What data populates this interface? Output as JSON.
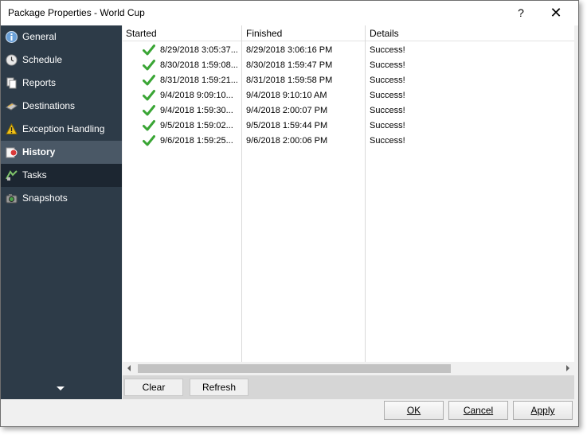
{
  "window": {
    "title": "Package Properties - World Cup",
    "help": "?",
    "close": "✕"
  },
  "sidebar": {
    "items": [
      {
        "label": "General",
        "icon": "info-icon"
      },
      {
        "label": "Schedule",
        "icon": "clock-icon"
      },
      {
        "label": "Reports",
        "icon": "reports-icon"
      },
      {
        "label": "Destinations",
        "icon": "destinations-icon"
      },
      {
        "label": "Exception Handling",
        "icon": "warning-icon"
      },
      {
        "label": "History",
        "icon": "history-icon",
        "active": true
      },
      {
        "label": "Tasks",
        "icon": "tasks-icon"
      },
      {
        "label": "Snapshots",
        "icon": "snapshots-icon"
      }
    ]
  },
  "grid": {
    "columns": [
      "Started",
      "Finished",
      "Details"
    ],
    "rows": [
      {
        "started": "8/29/2018 3:05:37...",
        "finished": "8/29/2018 3:06:16 PM",
        "details": "Success!"
      },
      {
        "started": "8/30/2018 1:59:08...",
        "finished": "8/30/2018 1:59:47 PM",
        "details": "Success!"
      },
      {
        "started": "8/31/2018 1:59:21...",
        "finished": "8/31/2018 1:59:58 PM",
        "details": "Success!"
      },
      {
        "started": "9/4/2018 9:09:10...",
        "finished": "9/4/2018 9:10:10 AM",
        "details": "Success!"
      },
      {
        "started": "9/4/2018 1:59:30...",
        "finished": "9/4/2018 2:00:07 PM",
        "details": "Success!"
      },
      {
        "started": "9/5/2018 1:59:02...",
        "finished": "9/5/2018 1:59:44 PM",
        "details": "Success!"
      },
      {
        "started": "9/6/2018 1:59:25...",
        "finished": "9/6/2018 2:00:06 PM",
        "details": "Success!"
      }
    ]
  },
  "actions": {
    "clear": "Clear",
    "refresh": "Refresh"
  },
  "footer": {
    "ok": "OK",
    "cancel": "Cancel",
    "apply": "Apply"
  },
  "colors": {
    "sidebar_bg": "#2d3b48",
    "sidebar_active": "#4a5866",
    "check": "#3aa535"
  }
}
